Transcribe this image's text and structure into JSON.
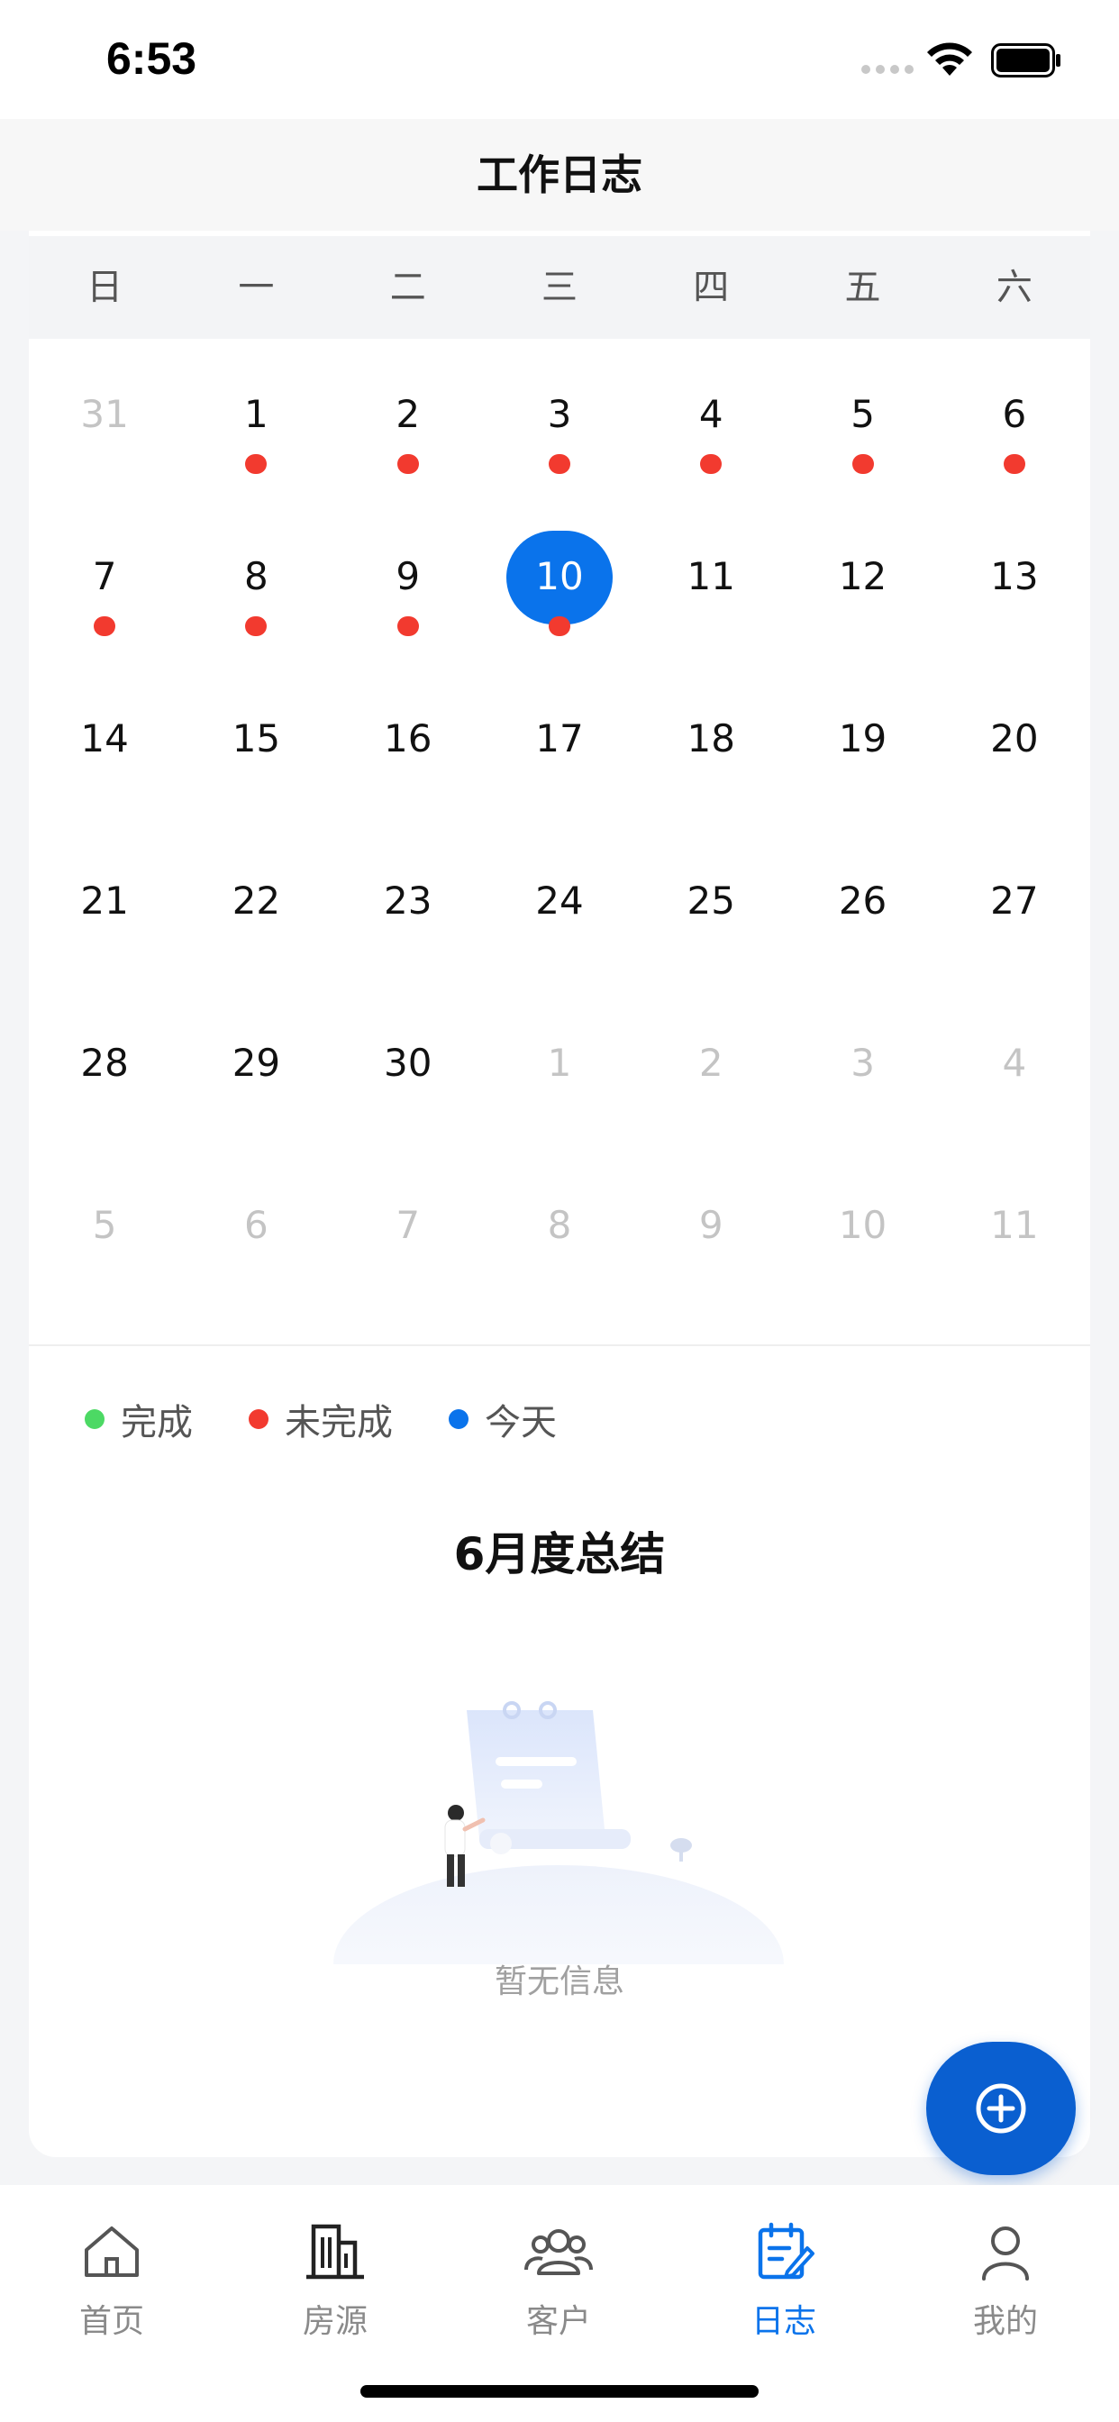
{
  "status_bar": {
    "time": "6:53"
  },
  "nav": {
    "title": "工作日志"
  },
  "calendar": {
    "weekdays": [
      "日",
      "一",
      "二",
      "三",
      "四",
      "五",
      "六"
    ],
    "days": [
      {
        "label": "31",
        "other": true,
        "dot": false,
        "today": false
      },
      {
        "label": "1",
        "other": false,
        "dot": true,
        "today": false
      },
      {
        "label": "2",
        "other": false,
        "dot": true,
        "today": false
      },
      {
        "label": "3",
        "other": false,
        "dot": true,
        "today": false
      },
      {
        "label": "4",
        "other": false,
        "dot": true,
        "today": false
      },
      {
        "label": "5",
        "other": false,
        "dot": true,
        "today": false
      },
      {
        "label": "6",
        "other": false,
        "dot": true,
        "today": false
      },
      {
        "label": "7",
        "other": false,
        "dot": true,
        "today": false
      },
      {
        "label": "8",
        "other": false,
        "dot": true,
        "today": false
      },
      {
        "label": "9",
        "other": false,
        "dot": true,
        "today": false
      },
      {
        "label": "10",
        "other": false,
        "dot": true,
        "today": true
      },
      {
        "label": "11",
        "other": false,
        "dot": false,
        "today": false
      },
      {
        "label": "12",
        "other": false,
        "dot": false,
        "today": false
      },
      {
        "label": "13",
        "other": false,
        "dot": false,
        "today": false
      },
      {
        "label": "14",
        "other": false,
        "dot": false,
        "today": false
      },
      {
        "label": "15",
        "other": false,
        "dot": false,
        "today": false
      },
      {
        "label": "16",
        "other": false,
        "dot": false,
        "today": false
      },
      {
        "label": "17",
        "other": false,
        "dot": false,
        "today": false
      },
      {
        "label": "18",
        "other": false,
        "dot": false,
        "today": false
      },
      {
        "label": "19",
        "other": false,
        "dot": false,
        "today": false
      },
      {
        "label": "20",
        "other": false,
        "dot": false,
        "today": false
      },
      {
        "label": "21",
        "other": false,
        "dot": false,
        "today": false
      },
      {
        "label": "22",
        "other": false,
        "dot": false,
        "today": false
      },
      {
        "label": "23",
        "other": false,
        "dot": false,
        "today": false
      },
      {
        "label": "24",
        "other": false,
        "dot": false,
        "today": false
      },
      {
        "label": "25",
        "other": false,
        "dot": false,
        "today": false
      },
      {
        "label": "26",
        "other": false,
        "dot": false,
        "today": false
      },
      {
        "label": "27",
        "other": false,
        "dot": false,
        "today": false
      },
      {
        "label": "28",
        "other": false,
        "dot": false,
        "today": false
      },
      {
        "label": "29",
        "other": false,
        "dot": false,
        "today": false
      },
      {
        "label": "30",
        "other": false,
        "dot": false,
        "today": false
      },
      {
        "label": "1",
        "other": true,
        "dot": false,
        "today": false
      },
      {
        "label": "2",
        "other": true,
        "dot": false,
        "today": false
      },
      {
        "label": "3",
        "other": true,
        "dot": false,
        "today": false
      },
      {
        "label": "4",
        "other": true,
        "dot": false,
        "today": false
      },
      {
        "label": "5",
        "other": true,
        "dot": false,
        "today": false
      },
      {
        "label": "6",
        "other": true,
        "dot": false,
        "today": false
      },
      {
        "label": "7",
        "other": true,
        "dot": false,
        "today": false
      },
      {
        "label": "8",
        "other": true,
        "dot": false,
        "today": false
      },
      {
        "label": "9",
        "other": true,
        "dot": false,
        "today": false
      },
      {
        "label": "10",
        "other": true,
        "dot": false,
        "today": false
      },
      {
        "label": "11",
        "other": true,
        "dot": false,
        "today": false
      }
    ]
  },
  "legend": [
    {
      "label": "完成",
      "color": "#4cd964"
    },
    {
      "label": "未完成",
      "color": "#f23a2f"
    },
    {
      "label": "今天",
      "color": "#0a73eb"
    }
  ],
  "summary": {
    "title": "6月度总结",
    "empty_text": "暂无信息"
  },
  "fab": {
    "icon": "plus-circle-icon"
  },
  "tabs": [
    {
      "label": "首页",
      "icon": "home-icon",
      "active": false
    },
    {
      "label": "房源",
      "icon": "building-icon",
      "active": false
    },
    {
      "label": "客户",
      "icon": "users-icon",
      "active": false
    },
    {
      "label": "日志",
      "icon": "log-icon",
      "active": true
    },
    {
      "label": "我的",
      "icon": "user-icon",
      "active": false
    }
  ],
  "colors": {
    "accent": "#0a73eb",
    "fab": "#0a5fd0",
    "incomplete": "#f23a2f",
    "complete": "#4cd964"
  }
}
